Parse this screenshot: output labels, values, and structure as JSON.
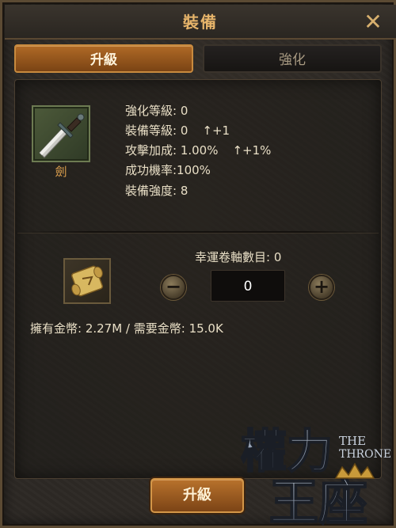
{
  "window": {
    "title": "裝備",
    "close_label": "✕"
  },
  "tabs": [
    {
      "label": "升級",
      "active": true
    },
    {
      "label": "強化",
      "active": false
    }
  ],
  "item": {
    "name": "劍",
    "icon": "sword-icon"
  },
  "stats": {
    "enhance_level": "強化等級: 0",
    "equip_level": "裝備等級: 0",
    "equip_level_change": "↑+1",
    "attack_bonus": "攻擊加成: 1.00%",
    "attack_bonus_change": "↑+1%",
    "success_rate": "成功機率:100%",
    "equip_strength": "裝備強度: 8"
  },
  "lucky_scroll": {
    "label": "幸運卷軸數目: 0",
    "count": "0",
    "minus_label": "−",
    "plus_label": "+",
    "icon": "scroll-icon"
  },
  "gold": {
    "text": "擁有金幣: 2.27M / 需要金幣: 15.0K"
  },
  "logo": {
    "title": "權力王座",
    "subtitle_line1": "THE",
    "subtitle_line2": "THRONE"
  },
  "action_button": {
    "label": "升級"
  },
  "colors": {
    "accent": "#b06a26",
    "title": "#e6b46a",
    "item_name": "#e0a24e",
    "background": "#2d2925"
  }
}
